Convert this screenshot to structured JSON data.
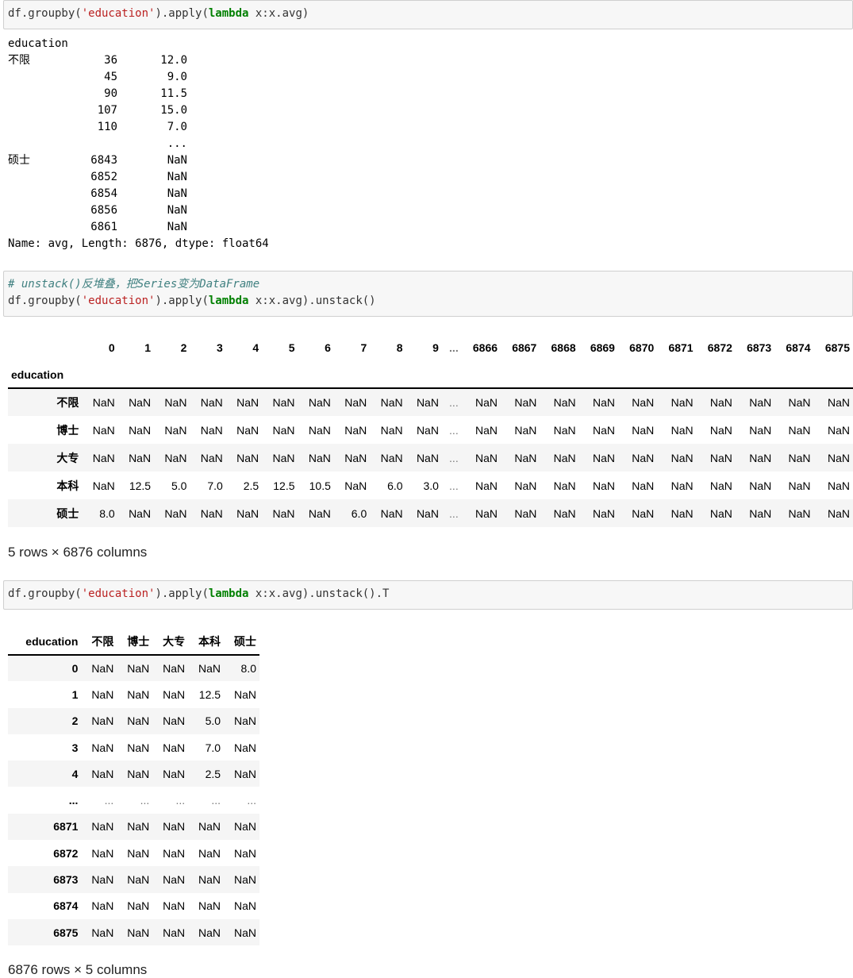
{
  "cells": [
    {
      "code": [
        {
          "t": "plain",
          "v": "df.groupby("
        },
        {
          "t": "str",
          "v": "'education'"
        },
        {
          "t": "plain",
          "v": ").apply("
        },
        {
          "t": "kw",
          "v": "lambda"
        },
        {
          "t": "plain",
          "v": " x:x.avg)"
        }
      ]
    },
    {
      "comment": "# unstack()反堆叠，把Series变为DataFrame",
      "code": [
        {
          "t": "plain",
          "v": "df.groupby("
        },
        {
          "t": "str",
          "v": "'education'"
        },
        {
          "t": "plain",
          "v": ").apply("
        },
        {
          "t": "kw",
          "v": "lambda"
        },
        {
          "t": "plain",
          "v": " x:x.avg).unstack()"
        }
      ]
    },
    {
      "code": [
        {
          "t": "plain",
          "v": "df.groupby("
        },
        {
          "t": "str",
          "v": "'education'"
        },
        {
          "t": "plain",
          "v": ").apply("
        },
        {
          "t": "kw",
          "v": "lambda"
        },
        {
          "t": "plain",
          "v": " x:x.avg).unstack().T"
        }
      ]
    }
  ],
  "series_output": {
    "header": "education",
    "rows": [
      [
        "不限",
        "36",
        "12.0"
      ],
      [
        "",
        "45",
        "9.0"
      ],
      [
        "",
        "90",
        "11.5"
      ],
      [
        "",
        "107",
        "15.0"
      ],
      [
        "",
        "110",
        "7.0"
      ],
      [
        "",
        "",
        "..."
      ],
      [
        "硕士",
        "6843",
        "NaN"
      ],
      [
        "",
        "6852",
        "NaN"
      ],
      [
        "",
        "6854",
        "NaN"
      ],
      [
        "",
        "6856",
        "NaN"
      ],
      [
        "",
        "6861",
        "NaN"
      ]
    ],
    "footer": "Name: avg, Length: 6876, dtype: float64"
  },
  "df_wide": {
    "index_name": "education",
    "columns": [
      "0",
      "1",
      "2",
      "3",
      "4",
      "5",
      "6",
      "7",
      "8",
      "9",
      "...",
      "6866",
      "6867",
      "6868",
      "6869",
      "6870",
      "6871",
      "6872",
      "6873",
      "6874",
      "6875"
    ],
    "rows": [
      {
        "index": "不限",
        "values": [
          "NaN",
          "NaN",
          "NaN",
          "NaN",
          "NaN",
          "NaN",
          "NaN",
          "NaN",
          "NaN",
          "NaN",
          "...",
          "NaN",
          "NaN",
          "NaN",
          "NaN",
          "NaN",
          "NaN",
          "NaN",
          "NaN",
          "NaN",
          "NaN"
        ]
      },
      {
        "index": "博士",
        "values": [
          "NaN",
          "NaN",
          "NaN",
          "NaN",
          "NaN",
          "NaN",
          "NaN",
          "NaN",
          "NaN",
          "NaN",
          "...",
          "NaN",
          "NaN",
          "NaN",
          "NaN",
          "NaN",
          "NaN",
          "NaN",
          "NaN",
          "NaN",
          "NaN"
        ]
      },
      {
        "index": "大专",
        "values": [
          "NaN",
          "NaN",
          "NaN",
          "NaN",
          "NaN",
          "NaN",
          "NaN",
          "NaN",
          "NaN",
          "NaN",
          "...",
          "NaN",
          "NaN",
          "NaN",
          "NaN",
          "NaN",
          "NaN",
          "NaN",
          "NaN",
          "NaN",
          "NaN"
        ]
      },
      {
        "index": "本科",
        "values": [
          "NaN",
          "12.5",
          "5.0",
          "7.0",
          "2.5",
          "12.5",
          "10.5",
          "NaN",
          "6.0",
          "3.0",
          "...",
          "NaN",
          "NaN",
          "NaN",
          "NaN",
          "NaN",
          "NaN",
          "NaN",
          "NaN",
          "NaN",
          "NaN"
        ]
      },
      {
        "index": "硕士",
        "values": [
          "8.0",
          "NaN",
          "NaN",
          "NaN",
          "NaN",
          "NaN",
          "NaN",
          "6.0",
          "NaN",
          "NaN",
          "...",
          "NaN",
          "NaN",
          "NaN",
          "NaN",
          "NaN",
          "NaN",
          "NaN",
          "NaN",
          "NaN",
          "NaN"
        ]
      }
    ],
    "shape": "5 rows × 6876 columns"
  },
  "df_tall": {
    "index_name": "education",
    "columns": [
      "不限",
      "博士",
      "大专",
      "本科",
      "硕士"
    ],
    "rows": [
      {
        "index": "0",
        "values": [
          "NaN",
          "NaN",
          "NaN",
          "NaN",
          "8.0"
        ]
      },
      {
        "index": "1",
        "values": [
          "NaN",
          "NaN",
          "NaN",
          "12.5",
          "NaN"
        ]
      },
      {
        "index": "2",
        "values": [
          "NaN",
          "NaN",
          "NaN",
          "5.0",
          "NaN"
        ]
      },
      {
        "index": "3",
        "values": [
          "NaN",
          "NaN",
          "NaN",
          "7.0",
          "NaN"
        ]
      },
      {
        "index": "4",
        "values": [
          "NaN",
          "NaN",
          "NaN",
          "2.5",
          "NaN"
        ]
      },
      {
        "index": "...",
        "values": [
          "...",
          "...",
          "...",
          "...",
          "..."
        ]
      },
      {
        "index": "6871",
        "values": [
          "NaN",
          "NaN",
          "NaN",
          "NaN",
          "NaN"
        ]
      },
      {
        "index": "6872",
        "values": [
          "NaN",
          "NaN",
          "NaN",
          "NaN",
          "NaN"
        ]
      },
      {
        "index": "6873",
        "values": [
          "NaN",
          "NaN",
          "NaN",
          "NaN",
          "NaN"
        ]
      },
      {
        "index": "6874",
        "values": [
          "NaN",
          "NaN",
          "NaN",
          "NaN",
          "NaN"
        ]
      },
      {
        "index": "6875",
        "values": [
          "NaN",
          "NaN",
          "NaN",
          "NaN",
          "NaN"
        ]
      }
    ],
    "shape": "6876 rows × 5 columns"
  }
}
